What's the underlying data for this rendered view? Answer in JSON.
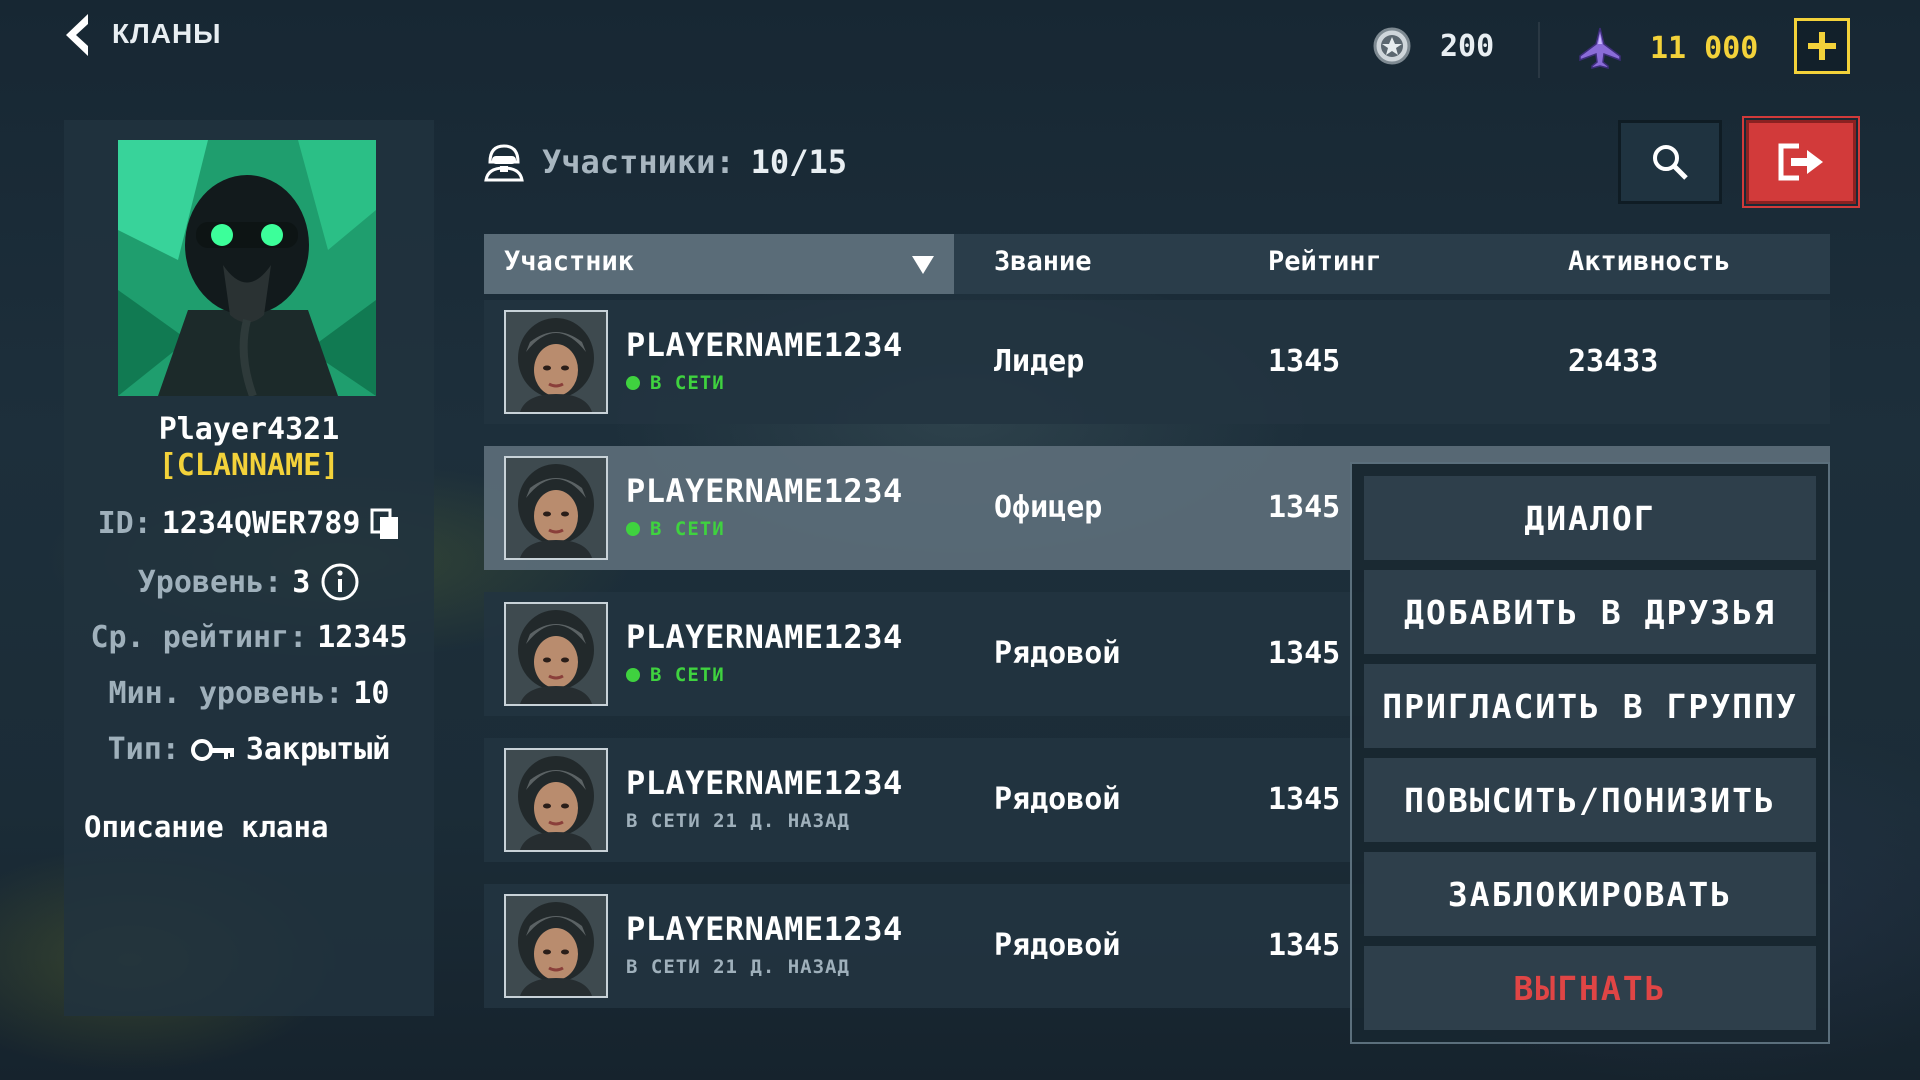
{
  "header": {
    "title": "КЛАНЫ",
    "currency_silver": "200",
    "currency_gold": "11 000",
    "silver_icon": "medal-icon",
    "gold_icon": "jet-icon",
    "add_icon": "plus-icon"
  },
  "profile": {
    "name": "Player4321",
    "clan": "[CLANNAME]",
    "id_label": "ID:",
    "id_value": "1234QWER789",
    "level_label": "Уровень:",
    "level_value": "3",
    "avg_rating_label": "Ср. рейтинг:",
    "avg_rating_value": "12345",
    "min_level_label": "Мин. уровень:",
    "min_level_value": "10",
    "type_label": "Тип:",
    "type_value": "Закрытый",
    "description_label": "Описание клана"
  },
  "members": {
    "label": "Участники:",
    "count": "10/15"
  },
  "table": {
    "columns": [
      "Участник",
      "Звание",
      "Рейтинг",
      "Активность"
    ],
    "rows": [
      {
        "name": "PLAYERNAME1234",
        "status": "В СЕТИ",
        "online": true,
        "rank": "Лидер",
        "rating": "1345",
        "activity": "23433"
      },
      {
        "name": "PLAYERNAME1234",
        "status": "В СЕТИ",
        "online": true,
        "rank": "Офицер",
        "rating": "1345",
        "activity": ""
      },
      {
        "name": "PLAYERNAME1234",
        "status": "В СЕТИ",
        "online": true,
        "rank": "Рядовой",
        "rating": "1345",
        "activity": ""
      },
      {
        "name": "PLAYERNAME1234",
        "status": "В СЕТИ 21 Д. НАЗАД",
        "online": false,
        "rank": "Рядовой",
        "rating": "1345",
        "activity": ""
      },
      {
        "name": "PLAYERNAME1234",
        "status": "В СЕТИ 21 Д. НАЗАД",
        "online": false,
        "rank": "Рядовой",
        "rating": "1345",
        "activity": ""
      }
    ]
  },
  "context_menu": {
    "items": [
      "ДИАЛОГ",
      "ДОБАВИТЬ В ДРУЗЬЯ",
      "ПРИГЛАСИТЬ В ГРУППУ",
      "ПОВЫСИТЬ/ПОНИЗИТЬ",
      "ЗАБЛОКИРОВАТЬ",
      "ВЫГНАТЬ"
    ]
  },
  "colors": {
    "accent_yellow": "#f3d23a",
    "online_green": "#3fd23f",
    "danger_red": "#d23a3a"
  }
}
